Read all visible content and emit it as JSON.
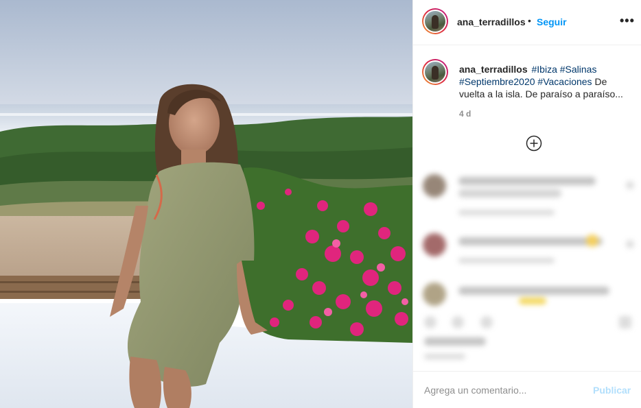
{
  "post": {
    "author": "ana_terradillos",
    "separator": "•",
    "follow_label": "Seguir",
    "more_label": "•••",
    "caption": {
      "author": "ana_terradillos",
      "tags": [
        "#Ibiza",
        "#Salinas",
        "#Septiembre2020",
        "#Vacaciones"
      ],
      "text": "De vuelta a la isla. De paraíso a paraíso..."
    },
    "time": "4 d"
  },
  "compose": {
    "placeholder": "Agrega un comentario...",
    "post_label": "Publicar"
  },
  "icons": {
    "avatar": "avatar-photo",
    "load_more": "plus-circle-icon",
    "more": "more-dots-icon"
  },
  "colors": {
    "link": "#0095f6",
    "hashtag": "#00376b",
    "muted": "#8e8e8e",
    "post_disabled": "#b2dffc"
  }
}
